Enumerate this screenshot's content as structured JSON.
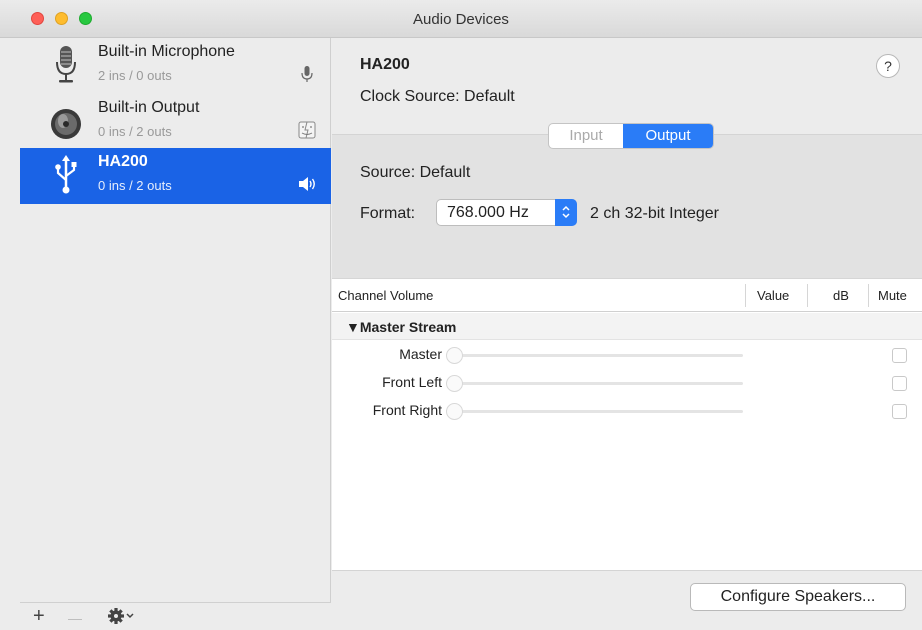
{
  "window": {
    "title": "Audio Devices"
  },
  "sidebar": {
    "devices": [
      {
        "name": "Built-in Microphone",
        "io": "2 ins / 0 outs",
        "icon": "microphone-icon",
        "status_icon": "mic-indicator-icon",
        "selected": false
      },
      {
        "name": "Built-in Output",
        "io": "0 ins / 2 outs",
        "icon": "speaker-icon",
        "status_icon": "finder-icon",
        "selected": false
      },
      {
        "name": "HA200",
        "io": "0 ins / 2 outs",
        "icon": "usb-icon",
        "status_icon": "speaker-volume-icon",
        "selected": true
      }
    ],
    "footer": {
      "add": "+",
      "remove": "—",
      "gear_icon": "gear-icon",
      "chevron_icon": "chevron-down-icon"
    }
  },
  "detail": {
    "device_name": "HA200",
    "clock_source": "Clock Source:  Default",
    "help": "?",
    "tabs": [
      {
        "label": "Input",
        "active": false
      },
      {
        "label": "Output",
        "active": true
      }
    ],
    "source": "Source:  Default",
    "format_label": "Format:",
    "format_value": "768.000 Hz",
    "format_desc": "2 ch 32-bit Integer",
    "table": {
      "columns": [
        "Channel Volume",
        "Value",
        "dB",
        "Mute"
      ],
      "group": "▼Master Stream",
      "channels": [
        {
          "label": "Master",
          "muted": false
        },
        {
          "label": "Front Left",
          "muted": false
        },
        {
          "label": "Front Right",
          "muted": false
        }
      ]
    },
    "configure_button": "Configure Speakers..."
  },
  "colors": {
    "selection": "#1a63e6",
    "accent": "#2a7cf7"
  }
}
